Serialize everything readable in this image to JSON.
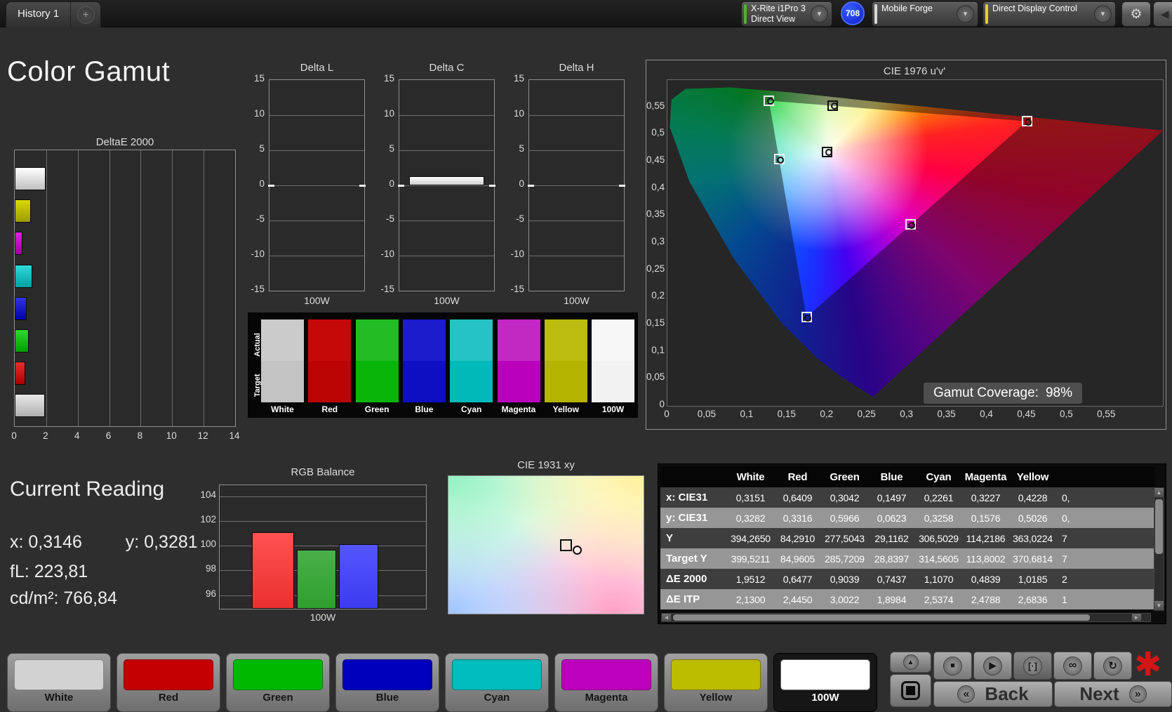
{
  "top_bar": {
    "tab_label": "History 1",
    "add_tab_label": "+",
    "meter_dropdown": {
      "line1": "X-Rite i1Pro 3",
      "line2": "Direct View",
      "accent": "#4db32b"
    },
    "badge": "708",
    "source_dropdown": {
      "label": "Mobile Forge",
      "accent": "#d9d9d9"
    },
    "control_dropdown": {
      "label": "Direct Display Control",
      "accent": "#e6d31d"
    },
    "gear_glyph": "⚙",
    "collapse_glyph": "◀",
    "chevron_glyph": "▼"
  },
  "page_title": "Color Gamut",
  "current_reading": {
    "title": "Current Reading",
    "x_label": "x:",
    "x_value": "0,3146",
    "y_label": "y:",
    "y_value": "0,3281",
    "fl_label": "fL:",
    "fl_value": "223,81",
    "cd_label": "cd/m²:",
    "cd_value": "766,84"
  },
  "swatch_strip": {
    "row_labels": [
      "Actual",
      "Target"
    ],
    "patterns": [
      {
        "label": "White",
        "actual": "#cbcbcb",
        "target": "#c3c3c3"
      },
      {
        "label": "Red",
        "actual": "#c50909",
        "target": "#bb0505"
      },
      {
        "label": "Green",
        "actual": "#24bc24",
        "target": "#0ab50a"
      },
      {
        "label": "Blue",
        "actual": "#1c1ccc",
        "target": "#0e0ec2"
      },
      {
        "label": "Cyan",
        "actual": "#25c3c3",
        "target": "#00baba"
      },
      {
        "label": "Magenta",
        "actual": "#c228c2",
        "target": "#ba00ba"
      },
      {
        "label": "Yellow",
        "actual": "#bcbc10",
        "target": "#b3b300"
      },
      {
        "label": "100W",
        "actual": "#f7f7f7",
        "target": "#f2f2f2"
      }
    ]
  },
  "table": {
    "headers": [
      "",
      "White",
      "Red",
      "Green",
      "Blue",
      "Cyan",
      "Magenta",
      "Yellow"
    ],
    "rows": [
      {
        "label": "x: CIE31",
        "values": [
          "0,3151",
          "0,6409",
          "0,3042",
          "0,1497",
          "0,2261",
          "0,3227",
          "0,4228"
        ],
        "clipped": "0,"
      },
      {
        "label": "y: CIE31",
        "values": [
          "0,3282",
          "0,3316",
          "0,5966",
          "0,0623",
          "0,3258",
          "0,1576",
          "0,5026"
        ],
        "clipped": "0,"
      },
      {
        "label": "Y",
        "values": [
          "394,2650",
          "84,2910",
          "277,5043",
          "29,1162",
          "306,5029",
          "114,2186",
          "363,0224"
        ],
        "clipped": "7"
      },
      {
        "label": "Target Y",
        "values": [
          "399,5211",
          "84,9605",
          "285,7209",
          "28,8397",
          "314,5605",
          "113,8002",
          "370,6814"
        ],
        "clipped": "7"
      },
      {
        "label": "ΔE 2000",
        "values": [
          "1,9512",
          "0,6477",
          "0,9039",
          "0,7437",
          "1,1070",
          "0,4839",
          "1,0185"
        ],
        "clipped": "2"
      },
      {
        "label": "ΔE ITP",
        "values": [
          "2,1300",
          "2,4450",
          "3,0022",
          "1,8984",
          "2,5374",
          "2,4788",
          "2,6836"
        ],
        "clipped": "1"
      }
    ]
  },
  "bottom_bar": {
    "patterns": [
      {
        "label": "White",
        "color": "#d2d2d2",
        "selected": false
      },
      {
        "label": "Red",
        "color": "#c40000",
        "selected": false
      },
      {
        "label": "Green",
        "color": "#00b800",
        "selected": false
      },
      {
        "label": "Blue",
        "color": "#0000bc",
        "selected": false
      },
      {
        "label": "Cyan",
        "color": "#00bcbc",
        "selected": false
      },
      {
        "label": "Magenta",
        "color": "#bc00bc",
        "selected": false
      },
      {
        "label": "Yellow",
        "color": "#bcbc00",
        "selected": false
      },
      {
        "label": "100W",
        "color": "#ffffff",
        "selected": true
      }
    ],
    "up_glyph": "▲",
    "transport": [
      {
        "name": "stop-button",
        "icon": "stop-icon",
        "glyph": "■",
        "pressed": false
      },
      {
        "name": "play-button",
        "icon": "play-icon",
        "glyph": "▶",
        "pressed": false
      },
      {
        "name": "pattern-size-button",
        "icon": "pattern-icon",
        "glyph": "[·]",
        "pressed": true
      },
      {
        "name": "loop-button",
        "icon": "loop-icon",
        "glyph": "∞",
        "pressed": false
      },
      {
        "name": "refresh-button",
        "icon": "refresh-icon",
        "glyph": "↻",
        "pressed": false
      }
    ],
    "back_label": "Back",
    "next_label": "Next",
    "back_chevron": "«",
    "next_chevron": "»",
    "asterisk_glyph": "✱"
  },
  "chart_data": [
    {
      "id": "deltaE2000",
      "type": "bar",
      "orientation": "horizontal",
      "title": "DeltaE 2000",
      "categories": [
        "White",
        "Yellow",
        "Magenta",
        "Cyan",
        "Blue",
        "Green",
        "Red",
        "100W"
      ],
      "values": [
        1.95,
        1.02,
        0.48,
        1.11,
        0.74,
        0.9,
        0.65,
        1.93
      ],
      "colors": [
        [
          "#ffffff",
          "#c0c0c0"
        ],
        [
          "#d9d900",
          "#9c9c00"
        ],
        [
          "#d926d9",
          "#9c009c"
        ],
        [
          "#2edbdb",
          "#00a0a0"
        ],
        [
          "#3333e6",
          "#0000aa"
        ],
        [
          "#2ed92e",
          "#00a000"
        ],
        [
          "#e62e2e",
          "#aa0000"
        ],
        [
          "#e8e8e8",
          "#b0b0b0"
        ]
      ],
      "xlim": [
        0,
        14
      ],
      "xticks": [
        0,
        2,
        4,
        6,
        8,
        10,
        12,
        14
      ],
      "grid": true
    },
    {
      "id": "deltaL",
      "type": "bar",
      "title": "Delta L",
      "categories": [
        "100W"
      ],
      "values": [
        0.0
      ],
      "xlabel": "100W",
      "ylim": [
        -15,
        15
      ],
      "yticks": [
        15,
        10,
        5,
        0,
        -5,
        -10,
        -15
      ],
      "grid": true
    },
    {
      "id": "deltaC",
      "type": "bar",
      "title": "Delta C",
      "categories": [
        "100W"
      ],
      "values": [
        1.3
      ],
      "xlabel": "100W",
      "ylim": [
        -15,
        15
      ],
      "yticks": [
        15,
        10,
        5,
        0,
        -5,
        -10,
        -15
      ],
      "grid": true
    },
    {
      "id": "deltaH",
      "type": "bar",
      "title": "Delta H",
      "categories": [
        "100W"
      ],
      "values": [
        0.0
      ],
      "xlabel": "100W",
      "ylim": [
        -15,
        15
      ],
      "yticks": [
        15,
        10,
        5,
        0,
        -5,
        -10,
        -15
      ],
      "grid": true
    },
    {
      "id": "rgb_balance",
      "type": "bar",
      "title": "RGB Balance",
      "categories": [
        "Red",
        "Green",
        "Blue"
      ],
      "values": [
        101.1,
        99.7,
        100.1
      ],
      "colors": [
        [
          "#ff5252",
          "#ea3030"
        ],
        [
          "#49b049",
          "#2f9f2f"
        ],
        [
          "#5555ff",
          "#3c3cef"
        ]
      ],
      "xlabel": "100W",
      "ylim": [
        94.9,
        104.9
      ],
      "yticks": [
        104,
        102,
        100,
        98,
        96
      ],
      "grid": true
    },
    {
      "id": "cie1976",
      "type": "scatter",
      "title": "CIE 1976 u'v'",
      "xlim": [
        0,
        0.62
      ],
      "ylim": [
        0,
        0.6
      ],
      "xticks": [
        0,
        0.05,
        0.1,
        0.15,
        0.2,
        0.25,
        0.3,
        0.35,
        0.4,
        0.45,
        0.5,
        0.55
      ],
      "xtick_labels": [
        "0",
        "0,05",
        "0,1",
        "0,15",
        "0,2",
        "0,25",
        "0,3",
        "0,35",
        "0,4",
        "0,45",
        "0,5",
        "0,55"
      ],
      "yticks": [
        0.55,
        0.5,
        0.45,
        0.4,
        0.35,
        0.3,
        0.25,
        0.2,
        0.15,
        0.1,
        0.05,
        0
      ],
      "ytick_labels": [
        "0,55",
        "0,5",
        "0,45",
        "0,4",
        "0,35",
        "0,3",
        "0,25",
        "0,2",
        "0,15",
        "0,1",
        "0,05",
        "0"
      ],
      "points": [
        {
          "name": "white",
          "u": 0.2,
          "v": 0.468,
          "outline": "#111111"
        },
        {
          "name": "red",
          "u": 0.45,
          "v": 0.524,
          "outline": "#eeeeee"
        },
        {
          "name": "green",
          "u": 0.127,
          "v": 0.562,
          "outline": "#eeeeee"
        },
        {
          "name": "blue",
          "u": 0.174,
          "v": 0.163,
          "outline": "#eeeeee"
        },
        {
          "name": "cyan",
          "u": 0.14,
          "v": 0.454,
          "outline": "#eeeeee"
        },
        {
          "name": "magenta",
          "u": 0.304,
          "v": 0.334,
          "outline": "#eeeeee"
        },
        {
          "name": "yellow",
          "u": 0.207,
          "v": 0.553,
          "outline": "#111111"
        }
      ],
      "gamut_triangle": [
        [
          0.45,
          0.524
        ],
        [
          0.127,
          0.562
        ],
        [
          0.174,
          0.163
        ]
      ],
      "annotation": {
        "label": "Gamut Coverage:",
        "value": "98%"
      }
    },
    {
      "id": "cie1931",
      "type": "scatter",
      "title": "CIE 1931 xy",
      "points": [
        {
          "name": "measurement",
          "x_pct": 60,
          "y_pct": 50
        }
      ]
    }
  ]
}
